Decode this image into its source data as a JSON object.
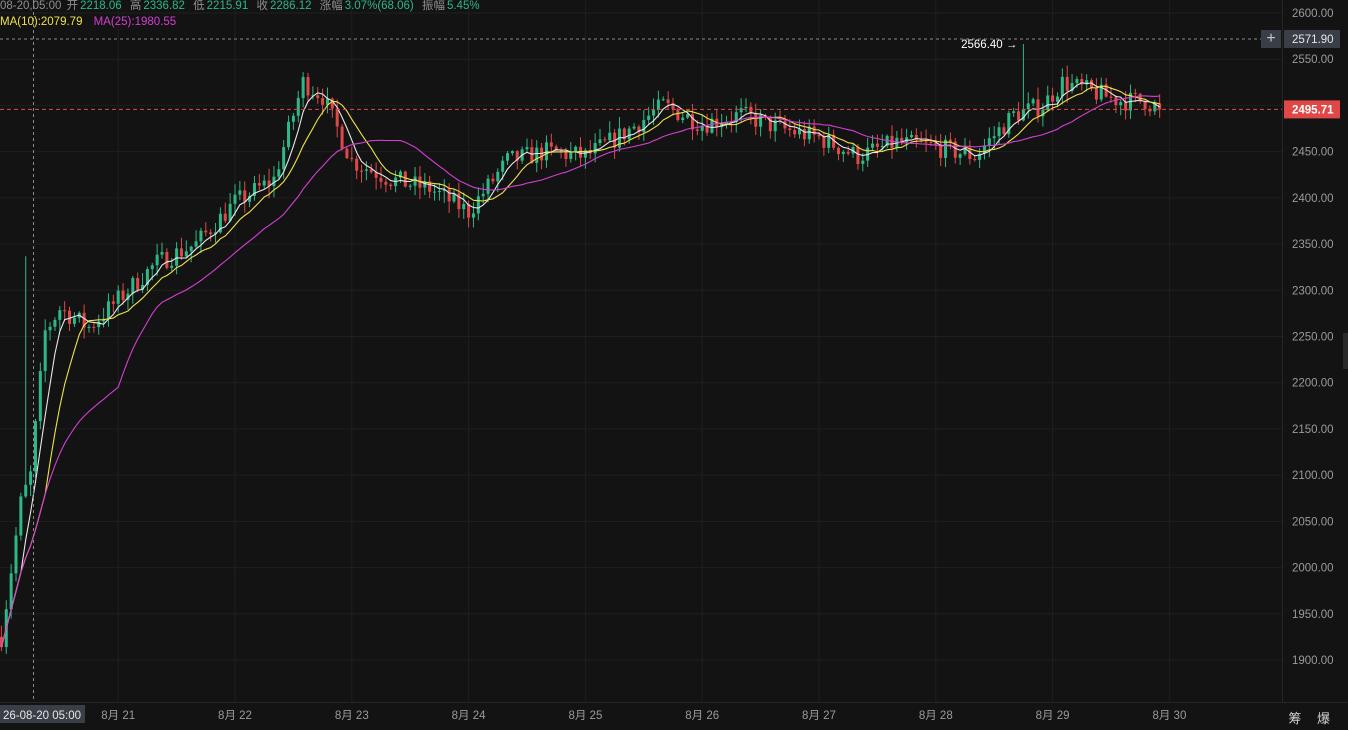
{
  "header": {
    "time": "08-20,05:00",
    "open_label": "开",
    "open": "2218.06",
    "high_label": "高",
    "high": "2336.82",
    "low_label": "低",
    "low": "2215.91",
    "close_label": "收",
    "close": "2286.12",
    "change_label": "涨幅",
    "change": "3.07%(68.06)",
    "amplitude_label": "振幅",
    "amplitude": "5.45%"
  },
  "ma": {
    "ma10_label": "MA(10):2079.79",
    "ma25_label": "MA(25):1980.55",
    "ma10_color": "#f0e24a",
    "ma25_color": "#d43fd4",
    "ma5_color": "#e8e8e8"
  },
  "colors": {
    "up": "#2eb886",
    "down": "#e04848",
    "grid": "#1f1f1f",
    "axis_text": "#9a9a9a",
    "crosshair": "#8a8a8a",
    "last_price_bg": "#e04848",
    "crosshair_label_bg": "#3a3f47"
  },
  "price_axis": {
    "labels": [
      "2600.00",
      "2550.00",
      "2500.00",
      "2450.00",
      "2400.00",
      "2350.00",
      "2300.00",
      "2250.00",
      "2200.00",
      "2150.00",
      "2100.00",
      "2050.00",
      "2000.00",
      "1950.00",
      "1900.00"
    ],
    "crosshair_price": "2571.90",
    "last_price": "2495.71"
  },
  "time_axis": {
    "crosshair_time": "26-08-20 05:00",
    "labels": [
      "8月 21",
      "8月 22",
      "8月 23",
      "8月 24",
      "8月 25",
      "8月 26",
      "8月 27",
      "8月 28",
      "8月 29",
      "8月 30"
    ]
  },
  "annotations": {
    "high_marker": "2566.40 →"
  },
  "tools": "筹 爆",
  "chart_data": {
    "type": "candlestick",
    "title": "",
    "interval": "1H",
    "ylim": [
      1870,
      2610
    ],
    "x_range": [
      "2026-08-20 00:00",
      "2026-08-30 23:00"
    ],
    "summary": {
      "first_close": 1925,
      "high": 2566.4,
      "last_close": 2495.71
    },
    "anchors": [
      [
        0,
        1925
      ],
      [
        4,
        2070
      ],
      [
        6,
        2100
      ],
      [
        9,
        2255
      ],
      [
        12,
        2280
      ],
      [
        18,
        2260
      ],
      [
        24,
        2290
      ],
      [
        32,
        2330
      ],
      [
        40,
        2350
      ],
      [
        48,
        2395
      ],
      [
        56,
        2420
      ],
      [
        62,
        2525
      ],
      [
        66,
        2510
      ],
      [
        72,
        2440
      ],
      [
        80,
        2420
      ],
      [
        88,
        2410
      ],
      [
        96,
        2385
      ],
      [
        104,
        2440
      ],
      [
        112,
        2450
      ],
      [
        120,
        2445
      ],
      [
        128,
        2470
      ],
      [
        136,
        2500
      ],
      [
        144,
        2480
      ],
      [
        152,
        2490
      ],
      [
        160,
        2475
      ],
      [
        168,
        2465
      ],
      [
        176,
        2445
      ],
      [
        184,
        2460
      ],
      [
        192,
        2455
      ],
      [
        200,
        2445
      ],
      [
        208,
        2490
      ],
      [
        214,
        2500
      ],
      [
        218,
        2525
      ],
      [
        224,
        2515
      ],
      [
        230,
        2505
      ],
      [
        235,
        2505
      ],
      [
        238,
        2495.71
      ]
    ],
    "moving_averages": [
      {
        "name": "MA(10)",
        "period": 10,
        "value": 2079.79
      },
      {
        "name": "MA(25)",
        "period": 25,
        "value": 1980.55
      }
    ],
    "crosshair": {
      "time": "26-08-20 05:00",
      "price": 2571.9
    },
    "last_price": 2495.71
  }
}
